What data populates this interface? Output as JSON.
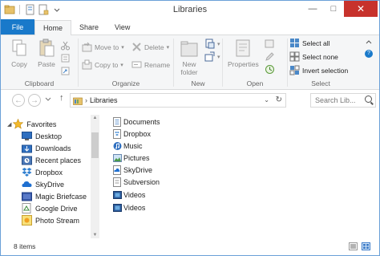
{
  "window": {
    "title": "Libraries"
  },
  "window_controls": {
    "minimize": "—",
    "maximize": "□",
    "close": "✕"
  },
  "tabs": [
    {
      "label": "File"
    },
    {
      "label": "Home"
    },
    {
      "label": "Share"
    },
    {
      "label": "View"
    }
  ],
  "ribbon": {
    "clipboard": {
      "label": "Clipboard",
      "copy": "Copy",
      "paste": "Paste"
    },
    "organize": {
      "label": "Organize",
      "move_to": "Move to",
      "copy_to": "Copy to",
      "delete": "Delete",
      "rename": "Rename"
    },
    "new": {
      "label": "New",
      "new_folder_line1": "New",
      "new_folder_line2": "folder"
    },
    "open": {
      "label": "Open",
      "properties": "Properties"
    },
    "select": {
      "label": "Select",
      "select_all": "Select all",
      "select_none": "Select none",
      "invert_selection": "Invert selection"
    }
  },
  "address": {
    "back_glyph": "←",
    "forward_glyph": "→",
    "up_glyph": "↑",
    "path_sep": "›",
    "path": "Libraries",
    "dropdown_glyph": "⌄",
    "refresh_glyph": "↻",
    "search_placeholder": "Search Lib..."
  },
  "navpane": {
    "favorites_label": "Favorites",
    "items": [
      {
        "label": "Desktop",
        "icon": "desktop-icon"
      },
      {
        "label": "Downloads",
        "icon": "downloads-icon"
      },
      {
        "label": "Recent places",
        "icon": "recent-places-icon"
      },
      {
        "label": "Dropbox",
        "icon": "dropbox-icon"
      },
      {
        "label": "SkyDrive",
        "icon": "skydrive-icon"
      },
      {
        "label": "Magic Briefcase",
        "icon": "briefcase-icon"
      },
      {
        "label": "Google Drive",
        "icon": "google-drive-icon"
      },
      {
        "label": "Photo Stream",
        "icon": "photo-stream-icon"
      }
    ]
  },
  "libraries": [
    {
      "label": "Documents",
      "icon": "documents-library-icon"
    },
    {
      "label": "Dropbox",
      "icon": "dropbox-library-icon"
    },
    {
      "label": "Music",
      "icon": "music-library-icon"
    },
    {
      "label": "Pictures",
      "icon": "pictures-library-icon"
    },
    {
      "label": "SkyDrive",
      "icon": "skydrive-library-icon"
    },
    {
      "label": "Subversion",
      "icon": "subversion-library-icon"
    },
    {
      "label": "Videos",
      "icon": "videos-library-icon"
    },
    {
      "label": "Videos",
      "icon": "videos-library-icon"
    }
  ],
  "status": {
    "item_count": "8 items"
  },
  "colors": {
    "file_tab": "#1979ca",
    "close_button": "#c7322c",
    "accent_border": "#6aa0d8"
  }
}
